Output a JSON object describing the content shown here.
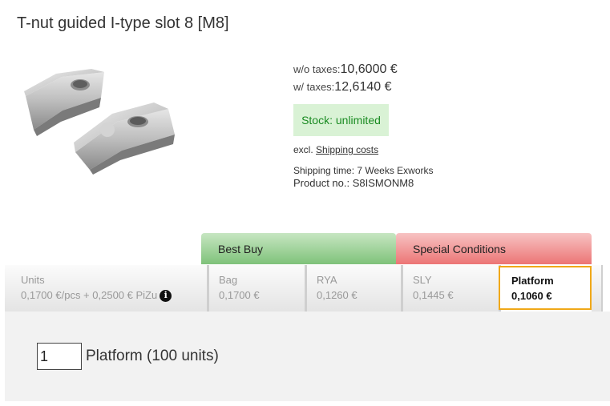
{
  "product": {
    "title": "T-nut guided I-type slot 8 [M8]",
    "price_net_label": "w/o taxes:",
    "price_net": "10,6000 €",
    "price_gross_label": "w/ taxes:",
    "price_gross": "12,6140 €",
    "stock": "Stock: unlimited",
    "excl_prefix": "excl.",
    "shipping_link": "Shipping costs",
    "shipping_time": "Shipping time: 7 Weeks Exworks",
    "product_no": "Product no.: S8ISMONM8"
  },
  "conditions": {
    "best_buy": "Best Buy",
    "special": "Special Conditions"
  },
  "tabs": [
    {
      "label": "Units",
      "value": "0,1700 €/pcs + 0,2500 € PiZu"
    },
    {
      "label": "Bag",
      "value": "0,1700 €"
    },
    {
      "label": "RYA",
      "value": "0,1260 €"
    },
    {
      "label": "SLY",
      "value": "0,1445 €"
    },
    {
      "label": "Platform",
      "value": "0,1060 €"
    }
  ],
  "order": {
    "quantity": "1",
    "unit_label": "Platform (100 units)"
  },
  "colors": {
    "stock_bg": "#d9f2d5",
    "stock_text": "#1a8b22",
    "best_buy": "#7fc27a",
    "special": "#ec7575",
    "active_border": "#f0a818"
  },
  "icons": {
    "info": "info-icon"
  }
}
